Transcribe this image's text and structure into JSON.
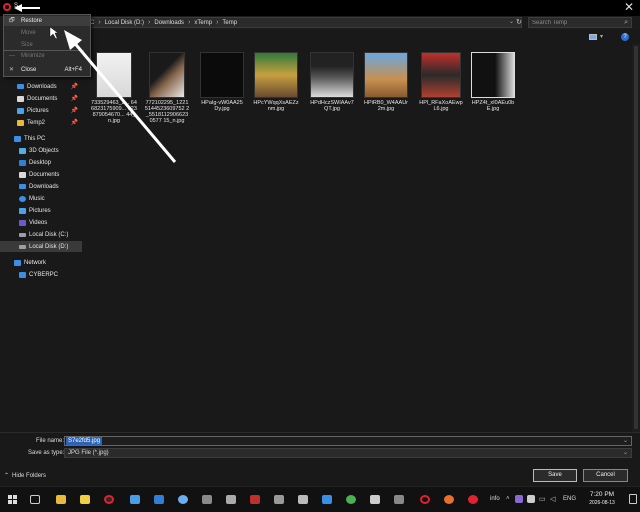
{
  "titlebar": {
    "title_letter": "S"
  },
  "address": {
    "crumbs": [
      "C",
      "Local Disk (D:)",
      "Downloads",
      "xTemp",
      "Temp"
    ],
    "search_placeholder": "Search Temp"
  },
  "context_menu": {
    "items": [
      {
        "glyph": "🗗",
        "label": "Restore",
        "shortcut": "",
        "enabled": true
      },
      {
        "glyph": "",
        "label": "Move",
        "shortcut": "",
        "enabled": false
      },
      {
        "glyph": "",
        "label": "Size",
        "shortcut": "",
        "enabled": false
      },
      {
        "glyph": "—",
        "label": "Minimize",
        "shortcut": "",
        "enabled": false
      },
      {
        "glyph": "✕",
        "label": "Close",
        "shortcut": "Alt+F4",
        "enabled": true
      }
    ]
  },
  "sidebar": {
    "quick_access": [
      {
        "label": "Downloads",
        "pinned": true
      },
      {
        "label": "Documents",
        "pinned": true
      },
      {
        "label": "Pictures",
        "pinned": true
      },
      {
        "label": "Temp2",
        "pinned": true
      }
    ],
    "this_pc": {
      "label": "This PC",
      "items": [
        "3D Objects",
        "Desktop",
        "Documents",
        "Downloads",
        "Music",
        "Pictures",
        "Videos",
        "Local Disk (C:)",
        "Local Disk (D:)"
      ]
    },
    "network": {
      "label": "Network",
      "items": [
        "CYBERPC"
      ]
    }
  },
  "files": [
    {
      "name": "733529463_2... 646823175909... 023879054670... 44_n.jpg"
    },
    {
      "name": "772102295_1221 5144523609752 2_5518112906623 0577 15_n.jpg"
    },
    {
      "name": "HPaIg-vW0AA25 Dy.jpg"
    },
    {
      "name": "HPcYWqqXsAEZz nm.jpg"
    },
    {
      "name": "HPdHczSWIAAv7 QT.jpg"
    },
    {
      "name": "HPiRB0_W4AAUr 2m.jpg"
    },
    {
      "name": "HPl_RFaXoAEwp L6.jpg"
    },
    {
      "name": "HPZ4t_xI0AEu0b E.jpg"
    }
  ],
  "form": {
    "filename_label": "File name:",
    "filename_value": "S7e2fd5.jpg",
    "savetype_label": "Save as type:",
    "savetype_value": "JPG File (*.jpg)",
    "save_label": "Save",
    "cancel_label": "Cancel",
    "hide_folders_label": "Hide Folders"
  },
  "taskbar": {
    "tray_info": "info",
    "language": "ENG",
    "time": "7:20 PM",
    "date": "2026-08-13"
  },
  "colors": {
    "accent": "#2a63b8",
    "opera_red": "#e0232e",
    "folder_yellow": "#e8b93a",
    "pc_blue": "#3a8ee6"
  }
}
